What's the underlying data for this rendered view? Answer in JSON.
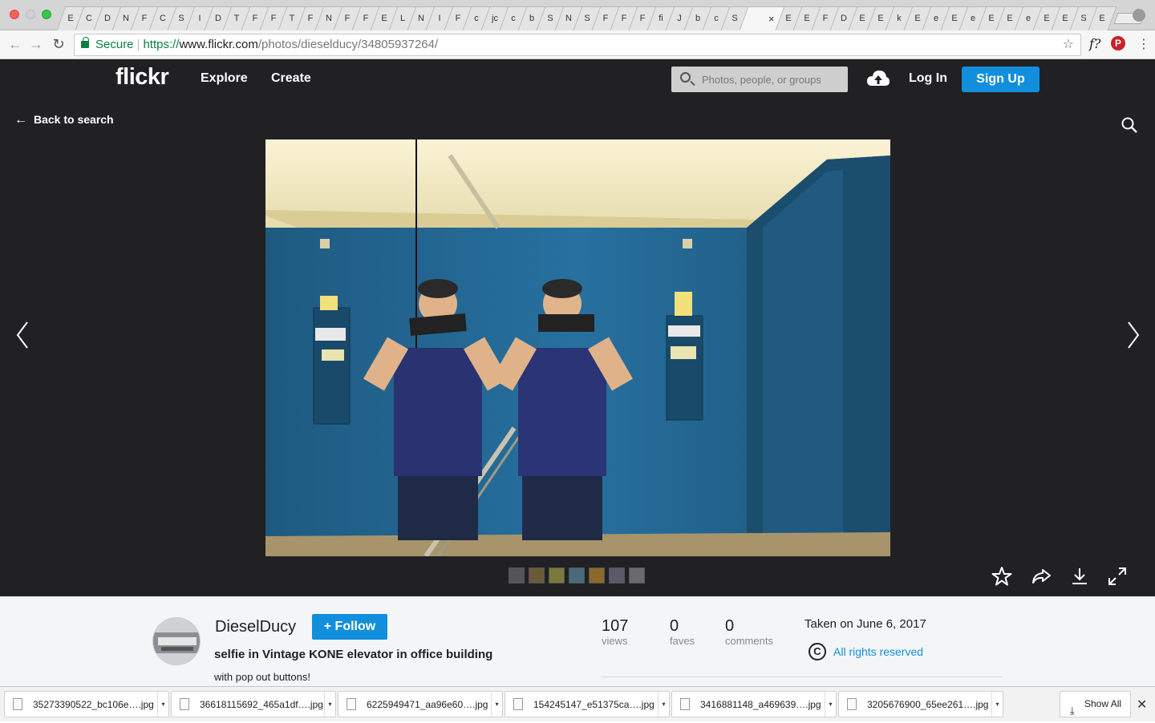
{
  "browser": {
    "tab_favicons": [
      "E",
      "C",
      "D",
      "N",
      "F",
      "C",
      "S",
      "I",
      "D",
      "T",
      "F",
      "F",
      "T",
      "F",
      "N",
      "F",
      "F",
      "E",
      "L",
      "N",
      "I",
      "F",
      "c",
      "jc",
      "c",
      "b",
      "S",
      "N",
      "S",
      "F",
      "F",
      "F",
      "fi",
      "J",
      "b",
      "c",
      "S"
    ],
    "active_tab_close": "×",
    "tab_favicons_after": [
      "E",
      "E",
      "F",
      "D",
      "E",
      "E",
      "k",
      "E",
      "e",
      "E",
      "e",
      "E",
      "E",
      "e",
      "E",
      "E",
      "S",
      "E"
    ],
    "url": {
      "secure_label": "Secure",
      "scheme": "https://",
      "host": "www.flickr.com",
      "path": "/photos/dieselducy/34805937264/"
    },
    "ext_fq": "f?",
    "ext_pin": "P"
  },
  "header": {
    "logo": "flickr",
    "nav": {
      "explore": "Explore",
      "create": "Create"
    },
    "search_placeholder": "Photos, people, or groups",
    "login": "Log In",
    "signup": "Sign Up"
  },
  "stage": {
    "back_label": "Back to search",
    "thumbnail_count": 7
  },
  "info": {
    "owner": "DieselDucy",
    "follow_label": "+ Follow",
    "title": "selfie in Vintage KONE elevator in office building",
    "description": "with pop out buttons!",
    "stats": [
      {
        "num": "107",
        "label": "views"
      },
      {
        "num": "0",
        "label": "faves"
      },
      {
        "num": "0",
        "label": "comments"
      }
    ],
    "taken": "Taken on June 6, 2017",
    "license_icon": "C",
    "license": "All rights reserved"
  },
  "downloads": {
    "files": [
      "35273390522_bc106e….jpg",
      "36618115692_465a1df….jpg",
      "6225949471_aa96e60….jpg",
      "154245147_e51375ca….jpg",
      "3416881148_a469639….jpg",
      "3205676900_65ee261….jpg"
    ],
    "show_all": "Show All",
    "close": "✕"
  },
  "colors": {
    "flickr_dark": "#212124",
    "flickr_blue": "#128fdc",
    "elevator_blue": "#1d5f86"
  }
}
